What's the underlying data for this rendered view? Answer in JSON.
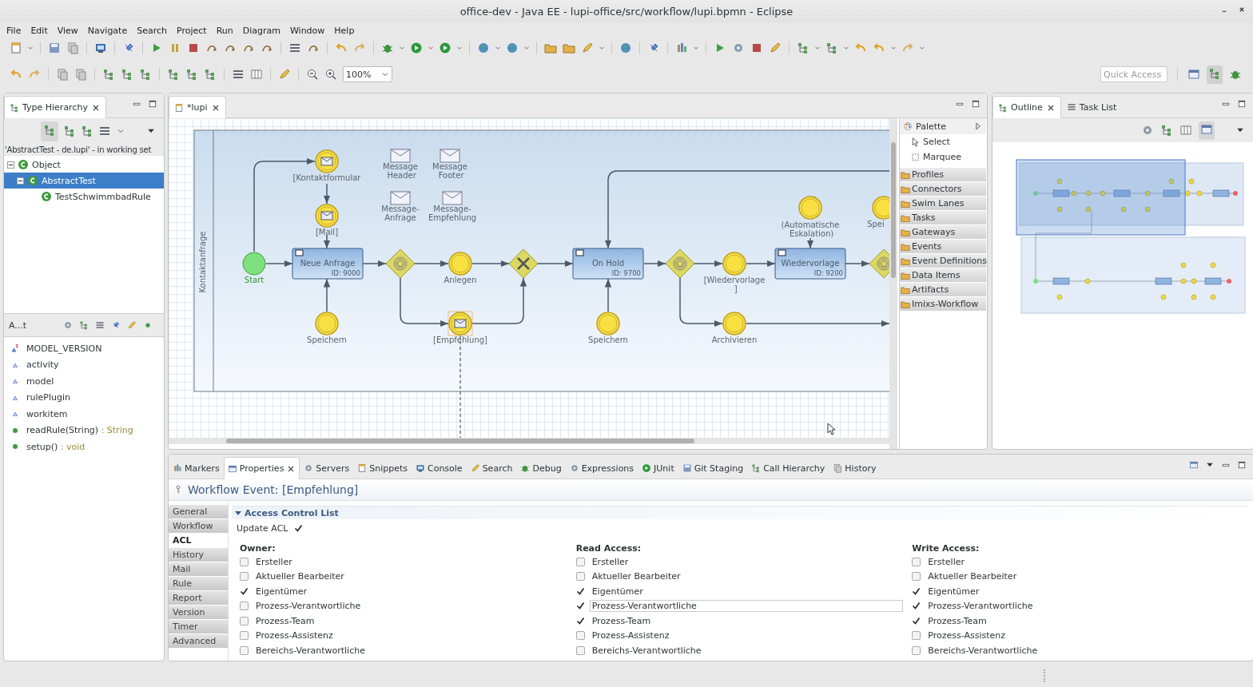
{
  "window": {
    "title": "office-dev - Java EE - lupi-office/src/workflow/lupi.bpmn - Eclipse"
  },
  "menu": [
    "File",
    "Edit",
    "View",
    "Navigate",
    "Search",
    "Project",
    "Run",
    "Diagram",
    "Window",
    "Help"
  ],
  "zoom_combo": {
    "value": "100%"
  },
  "quick_access": {
    "placeholder": "Quick Access"
  },
  "type_hierarchy": {
    "tabs": [
      {
        "label": "Type Hierarchy",
        "selected": true
      }
    ],
    "caption": "'AbstractTest - de.lupi' - in working set",
    "tree": [
      {
        "label": "Object",
        "expanded": true,
        "selected": false,
        "children": [
          {
            "label": "AbstractTest",
            "expanded": true,
            "selected": true,
            "children": [
              {
                "label": "TestSchwimmbadRule",
                "selected": false
              }
            ]
          }
        ]
      }
    ],
    "members_title": "A...t",
    "members": [
      {
        "kind": "constant",
        "name": "MODEL_VERSION"
      },
      {
        "kind": "field",
        "name": "activity"
      },
      {
        "kind": "field",
        "name": "model"
      },
      {
        "kind": "field",
        "name": "rulePlugin"
      },
      {
        "kind": "field",
        "name": "workitem"
      },
      {
        "kind": "method",
        "name": "readRule(String)",
        "type": " : String"
      },
      {
        "kind": "method",
        "name": "setup()",
        "type": " : void"
      }
    ]
  },
  "editor": {
    "tabs": [
      {
        "label": "*lupi",
        "selected": true
      }
    ],
    "lane": "Kontaktanfrage",
    "nodes": [
      {
        "kind": "start",
        "label": "Start"
      },
      {
        "kind": "message_event",
        "label": "[Kontaktformular",
        "selected": false
      },
      {
        "kind": "message_event",
        "label": "[Mail]",
        "selected": false
      },
      {
        "kind": "task",
        "label": "Neue Anfrage",
        "id": "ID: 9000"
      },
      {
        "kind": "event",
        "label": "Speichern"
      },
      {
        "kind": "event_gateway"
      },
      {
        "kind": "event",
        "label": "Anlegen"
      },
      {
        "kind": "message_event",
        "label": "[Empfehlung]",
        "selected": true
      },
      {
        "kind": "exclusive_gateway"
      },
      {
        "kind": "task",
        "label": "On Hold",
        "id": "ID: 9700"
      },
      {
        "kind": "event",
        "label": "Speichern"
      },
      {
        "kind": "event_gateway"
      },
      {
        "kind": "event",
        "label": "[Wiedervorlage ]"
      },
      {
        "kind": "event",
        "label": "Archivieren"
      },
      {
        "kind": "event",
        "label": "(Automatische Eskalation)"
      },
      {
        "kind": "task",
        "label": "Wiedervorlage",
        "id": "ID: 9200"
      },
      {
        "kind": "event_gateway"
      },
      {
        "kind": "event",
        "label": "Spei"
      },
      {
        "kind": "message",
        "label": "Message Header"
      },
      {
        "kind": "message",
        "label": "Message Footer"
      },
      {
        "kind": "message",
        "label": "Message-Anfrage"
      },
      {
        "kind": "message",
        "label": "Message-Empfehlung"
      }
    ],
    "palette": {
      "title": "Palette",
      "tools": [
        {
          "kind": "select",
          "label": "Select"
        },
        {
          "kind": "marquee",
          "label": "Marquee"
        }
      ],
      "drawers": [
        "Profiles",
        "Connectors",
        "Swim Lanes",
        "Tasks",
        "Gateways",
        "Events",
        "Event Definitions",
        "Data Items",
        "Artifacts",
        "Imixs-Workflow"
      ]
    }
  },
  "outline": {
    "tabs": [
      {
        "label": "Outline",
        "selected": true,
        "kind": "outline"
      },
      {
        "label": "Task List",
        "selected": false,
        "kind": "tasks"
      }
    ]
  },
  "bottom": {
    "tabs": [
      {
        "label": "Markers",
        "selected": false
      },
      {
        "label": "Properties",
        "selected": true
      },
      {
        "label": "Servers",
        "selected": false
      },
      {
        "label": "Snippets",
        "selected": false
      },
      {
        "label": "Console",
        "selected": false
      },
      {
        "label": "Search",
        "selected": false
      },
      {
        "label": "Debug",
        "selected": false
      },
      {
        "label": "Expressions",
        "selected": false
      },
      {
        "label": "JUnit",
        "selected": false
      },
      {
        "label": "Git Staging",
        "selected": false
      },
      {
        "label": "Call Hierarchy",
        "selected": false
      },
      {
        "label": "History",
        "selected": false
      }
    ],
    "title": "Workflow Event: [Empfehlung]",
    "side_tabs": [
      {
        "label": "General",
        "selected": false
      },
      {
        "label": "Workflow",
        "selected": false
      },
      {
        "label": "ACL",
        "selected": true
      },
      {
        "label": "History",
        "selected": false
      },
      {
        "label": "Mail",
        "selected": false
      },
      {
        "label": "Rule",
        "selected": false
      },
      {
        "label": "Report",
        "selected": false
      },
      {
        "label": "Version",
        "selected": false
      },
      {
        "label": "Timer",
        "selected": false
      },
      {
        "label": "Advanced",
        "selected": false
      }
    ],
    "section": {
      "title": "Access Control List",
      "expanded": true
    },
    "update_acl": {
      "label": "Update ACL",
      "checked": true
    },
    "columns": [
      {
        "title": "Owner:",
        "items": [
          {
            "label": "Ersteller",
            "checked": false,
            "focused": false
          },
          {
            "label": "Aktueller Bearbeiter",
            "checked": false,
            "focused": false
          },
          {
            "label": "Eigentümer",
            "checked": true,
            "focused": false
          },
          {
            "label": "Prozess-Verantwortliche",
            "checked": false,
            "focused": false
          },
          {
            "label": "Prozess-Team",
            "checked": false,
            "focused": false
          },
          {
            "label": "Prozess-Assistenz",
            "checked": false,
            "focused": false
          },
          {
            "label": "Bereichs-Verantwortliche",
            "checked": false,
            "focused": false
          }
        ]
      },
      {
        "title": "Read Access:",
        "items": [
          {
            "label": "Ersteller",
            "checked": false,
            "focused": false
          },
          {
            "label": "Aktueller Bearbeiter",
            "checked": false,
            "focused": false
          },
          {
            "label": "Eigentümer",
            "checked": true,
            "focused": false
          },
          {
            "label": "Prozess-Verantwortliche",
            "checked": true,
            "focused": true
          },
          {
            "label": "Prozess-Team",
            "checked": true,
            "focused": false
          },
          {
            "label": "Prozess-Assistenz",
            "checked": false,
            "focused": false
          },
          {
            "label": "Bereichs-Verantwortliche",
            "checked": false,
            "focused": false
          }
        ]
      },
      {
        "title": "Write Access:",
        "items": [
          {
            "label": "Ersteller",
            "checked": false,
            "focused": false
          },
          {
            "label": "Aktueller Bearbeiter",
            "checked": false,
            "focused": false
          },
          {
            "label": "Eigentümer",
            "checked": true,
            "focused": false
          },
          {
            "label": "Prozess-Verantwortliche",
            "checked": true,
            "focused": false
          },
          {
            "label": "Prozess-Team",
            "checked": true,
            "focused": false
          },
          {
            "label": "Prozess-Assistenz",
            "checked": false,
            "focused": false
          },
          {
            "label": "Bereichs-Verantwortliche",
            "checked": false,
            "focused": false
          }
        ]
      }
    ]
  }
}
